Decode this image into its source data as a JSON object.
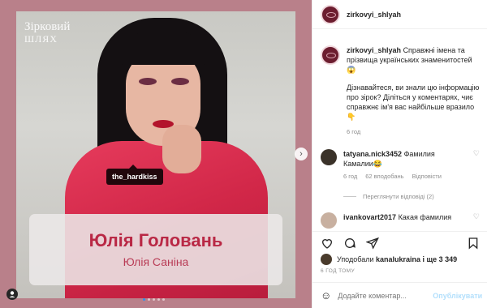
{
  "media": {
    "brand_line1": "Зірковий",
    "brand_line2": "ШЛЯХ",
    "tag": "the_hardkiss",
    "name_primary": "Юлія Головань",
    "name_secondary": "Юлія Саніна",
    "next_icon": "chevron-right-icon",
    "dots_count": 5,
    "active_dot": 1
  },
  "header": {
    "username": "zirkovyi_shlyah"
  },
  "caption": {
    "username": "zirkovyi_shlyah",
    "text": "Справжні імена та прізвища українських знаменитостей 😱",
    "text2": "Дізнавайтеся, ви знали цю інформацію про зірок? Діліться у коментарях, чиє справжнє ім'я вас найбільше вразило 👇",
    "time": "6 год"
  },
  "comments": [
    {
      "username": "tatyana.nick3452",
      "text": "Фамилия Камалии😂",
      "time": "6 год",
      "likes": "62 вподобань",
      "reply": "Відповісти",
      "view_replies": "Переглянути відповіді (2)"
    },
    {
      "username": "ivankovart2017",
      "text": "Какая фамилия"
    }
  ],
  "actions": {
    "likes_prefix": "Уподобали ",
    "likes_user": "kanalukraina",
    "likes_suffix": " і ще 3 349",
    "ago": "6 ГОД ТОМУ"
  },
  "add_comment": {
    "placeholder": "Додайте коментар...",
    "post_label": "Опублікувати"
  },
  "colors": {
    "frame": "#b9808a",
    "shirt": "#d12748",
    "name_text": "#b92845",
    "link_blue": "#b2dffc"
  }
}
